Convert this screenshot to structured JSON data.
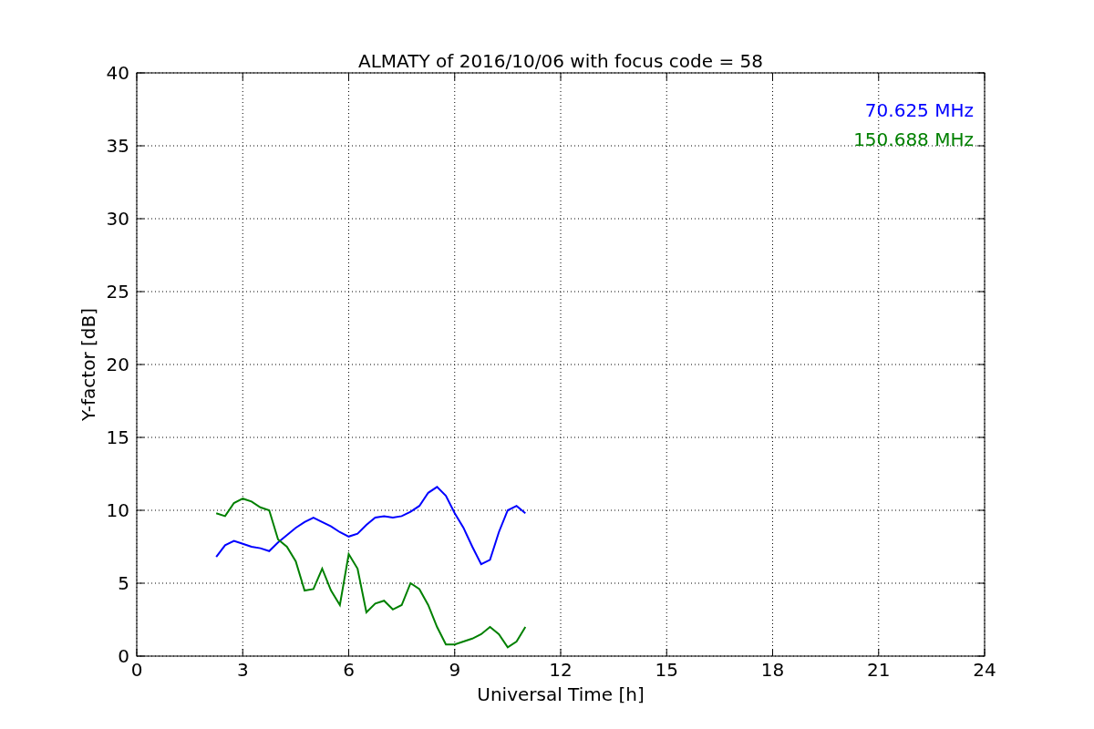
{
  "figure": {
    "chart_data": {
      "type": "line",
      "title": "ALMATY of 2016/10/06 with focus code = 58",
      "xlabel": "Universal Time [h]",
      "ylabel": "Y-factor [dB]",
      "x": [
        2.25,
        2.5,
        2.75,
        3,
        3.25,
        3.5,
        3.75,
        4,
        4.25,
        4.5,
        4.75,
        5,
        5.25,
        5.5,
        5.75,
        6,
        6.25,
        6.5,
        6.75,
        7,
        7.25,
        7.5,
        7.75,
        8,
        8.25,
        8.5,
        8.75,
        9,
        9.25,
        9.5,
        9.75,
        10,
        10.25,
        10.5,
        10.75,
        11
      ],
      "series": [
        {
          "name": "70.625 MHz",
          "color": "#0000ff",
          "values": [
            6.8,
            7.6,
            7.9,
            7.7,
            7.5,
            7.4,
            7.2,
            7.8,
            8.3,
            8.8,
            9.2,
            9.5,
            9.2,
            8.9,
            8.5,
            8.2,
            8.4,
            9.0,
            9.5,
            9.6,
            9.5,
            9.6,
            9.9,
            10.3,
            11.2,
            11.6,
            11.0,
            9.8,
            8.8,
            7.5,
            6.3,
            6.6,
            8.5,
            10.0,
            10.3,
            9.8
          ]
        },
        {
          "name": "150.688 MHz",
          "color": "#008000",
          "values": [
            9.8,
            9.6,
            10.5,
            10.8,
            10.6,
            10.2,
            10.0,
            8.0,
            7.5,
            6.5,
            4.5,
            4.6,
            6.0,
            4.5,
            3.5,
            7.0,
            6.0,
            3.0,
            3.6,
            3.8,
            3.2,
            3.5,
            5.0,
            4.6,
            3.5,
            2.0,
            0.8,
            0.8,
            1.0,
            1.2,
            1.5,
            2.0,
            1.5,
            0.6,
            1.0,
            2.0
          ]
        }
      ],
      "xlim": [
        0,
        24
      ],
      "ylim": [
        0,
        40
      ],
      "xticks": [
        0,
        3,
        6,
        9,
        12,
        15,
        18,
        21,
        24
      ],
      "yticks": [
        0,
        5,
        10,
        15,
        20,
        25,
        30,
        35,
        40
      ],
      "grid": true
    }
  }
}
